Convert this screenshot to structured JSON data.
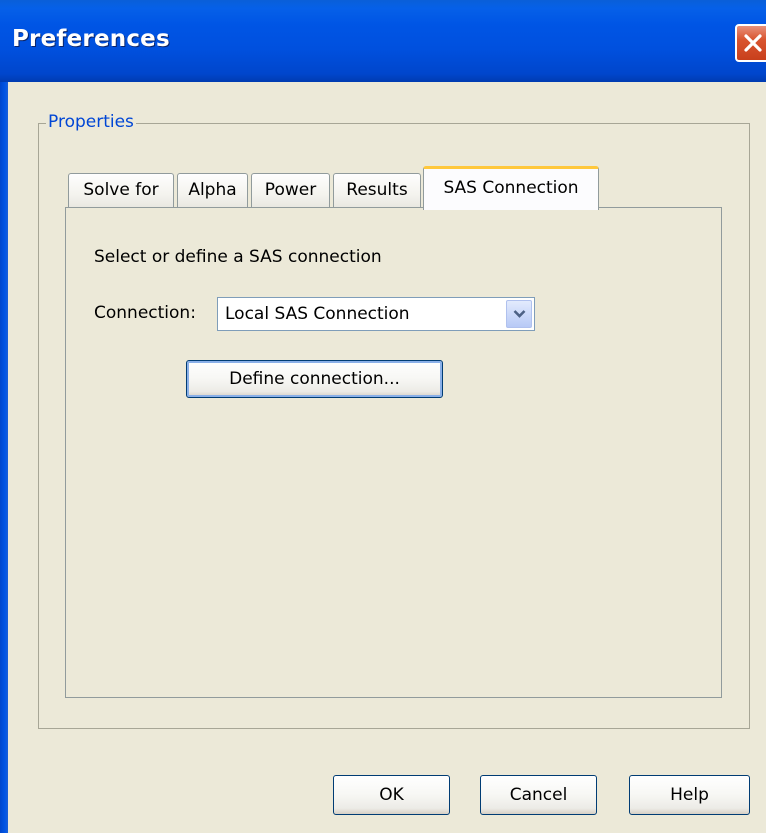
{
  "window": {
    "title": "Preferences"
  },
  "group": {
    "legend": "Properties"
  },
  "tabs": [
    {
      "label": "Solve for",
      "active": false
    },
    {
      "label": "Alpha",
      "active": false
    },
    {
      "label": "Power",
      "active": false
    },
    {
      "label": "Results",
      "active": false
    },
    {
      "label": "SAS Connection",
      "active": true
    }
  ],
  "panel": {
    "instruction": "Select or define a SAS connection",
    "connection_label": "Connection:",
    "connection_value": "Local SAS Connection",
    "define_button": "Define connection..."
  },
  "footer": {
    "ok": "OK",
    "cancel": "Cancel",
    "help": "Help"
  },
  "icons": {
    "close": "close-icon",
    "dropdown": "chevron-down-icon"
  },
  "colors": {
    "titlebar": "#0055e5",
    "window_bg": "#ece9d8",
    "legend_text": "#0046d5",
    "active_tab_highlight": "#ffc83c",
    "close_button": "#d9542f"
  }
}
